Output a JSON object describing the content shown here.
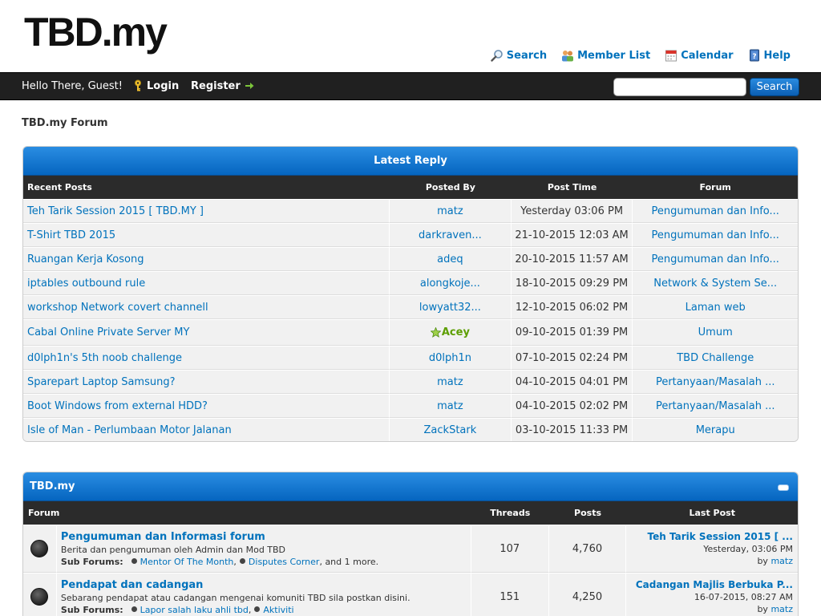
{
  "header": {
    "logo": "TBD.my",
    "links": [
      {
        "label": "Search",
        "icon": "search-icon"
      },
      {
        "label": "Member List",
        "icon": "members-icon"
      },
      {
        "label": "Calendar",
        "icon": "calendar-icon"
      },
      {
        "label": "Help",
        "icon": "help-icon"
      }
    ]
  },
  "panel": {
    "welcome": "Hello There, Guest!",
    "login": "Login",
    "register": "Register",
    "search_value": "",
    "search_button": "Search"
  },
  "breadcrumb": "TBD.my Forum",
  "latest": {
    "title": "Latest Reply",
    "columns": [
      "Recent Posts",
      "Posted By",
      "Post Time",
      "Forum"
    ],
    "rows": [
      {
        "post": "Teh Tarik Session 2015 [ TBD.MY ]",
        "by": "matz",
        "time": "Yesterday 03:06 PM",
        "forum": "Pengumuman dan Info..."
      },
      {
        "post": "T-Shirt TBD 2015",
        "by": "darkraven...",
        "time": "21-10-2015 12:03 AM",
        "forum": "Pengumuman dan Info..."
      },
      {
        "post": "Ruangan Kerja Kosong",
        "by": "adeq",
        "time": "20-10-2015 11:57 AM",
        "forum": "Pengumuman dan Info..."
      },
      {
        "post": "iptables outbound rule",
        "by": "alongkoje...",
        "time": "18-10-2015 09:29 PM",
        "forum": "Network & System Se..."
      },
      {
        "post": "workshop Network covert channell",
        "by": "lowyatt32...",
        "time": "12-10-2015 06:02 PM",
        "forum": "Laman web"
      },
      {
        "post": "Cabal Online Private Server MY",
        "by": "Acey",
        "time": "09-10-2015 01:39 PM",
        "forum": "Umum"
      },
      {
        "post": "d0lph1n's 5th noob challenge",
        "by": "d0lph1n",
        "time": "07-10-2015 02:24 PM",
        "forum": "TBD Challenge"
      },
      {
        "post": "Sparepart Laptop Samsung?",
        "by": "matz",
        "time": "04-10-2015 04:01 PM",
        "forum": "Pertanyaan/Masalah ..."
      },
      {
        "post": "Boot Windows from external HDD?",
        "by": "matz",
        "time": "04-10-2015 02:02 PM",
        "forum": "Pertanyaan/Masalah ..."
      },
      {
        "post": "Isle of Man - Perlumbaan Motor Jalanan",
        "by": "ZackStark",
        "time": "03-10-2015 11:33 PM",
        "forum": "Merapu"
      }
    ]
  },
  "forum": {
    "title": "TBD.my",
    "columns": [
      "Forum",
      "Threads",
      "Posts",
      "Last Post"
    ],
    "sub_label": "Sub Forums:",
    "rows": [
      {
        "name": "Pengumuman dan Informasi forum",
        "desc": "Berita dan pengumuman oleh Admin dan Mod TBD",
        "subs": [
          "Mentor Of The Month",
          "Disputes Corner"
        ],
        "more": ", and 1 more.",
        "threads": "107",
        "posts": "4,760",
        "last_title": "Teh Tarik Session 2015 [ ...",
        "last_date": "Yesterday, 03:06 PM",
        "by_label": "by",
        "last_by": "matz"
      },
      {
        "name": "Pendapat dan cadangan",
        "desc": "Sebarang pendapat atau cadangan mengenai komuniti TBD sila postkan disini.",
        "subs": [
          "Lapor salah laku ahli tbd",
          "Aktiviti"
        ],
        "more": "",
        "threads": "151",
        "posts": "4,250",
        "last_title": "Cadangan Majlis Berbuka P...",
        "last_date": "16-07-2015, 08:27 AM",
        "by_label": "by",
        "last_by": "matz"
      }
    ]
  }
}
